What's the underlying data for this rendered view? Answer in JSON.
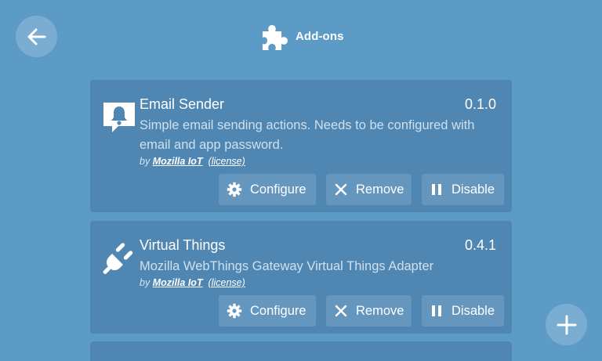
{
  "header": {
    "title": "Add-ons"
  },
  "addons": [
    {
      "name": "Email Sender",
      "version": "0.1.0",
      "description": "Simple email sending actions. Needs to be configured with email and app password.",
      "by_prefix": "by",
      "author": "Mozilla IoT",
      "license_label": "(license)",
      "icon": "notification-bell-icon",
      "buttons": {
        "configure": "Configure",
        "remove": "Remove",
        "disable": "Disable"
      }
    },
    {
      "name": "Virtual Things",
      "version": "0.4.1",
      "description": "Mozilla WebThings Gateway Virtual Things Adapter",
      "by_prefix": "by",
      "author": "Mozilla IoT",
      "license_label": "(license)",
      "icon": "plug-icon",
      "buttons": {
        "configure": "Configure",
        "remove": "Remove",
        "disable": "Disable"
      }
    }
  ],
  "colors": {
    "background": "#5d9bc7",
    "card": "#4f86b2",
    "button": "#6596be"
  }
}
